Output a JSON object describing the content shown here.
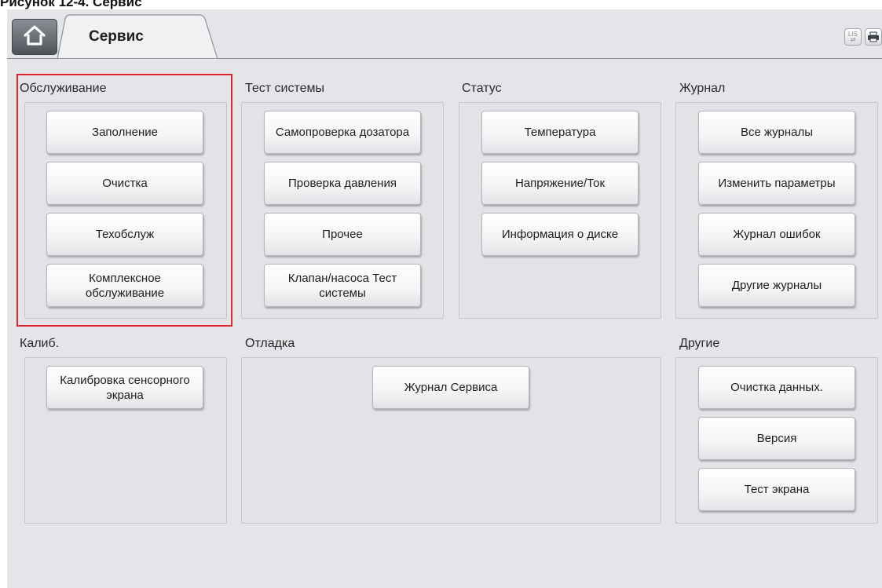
{
  "caption": "Рисунок 12-4. Сервис",
  "header": {
    "tab_label": "Сервис",
    "icons": {
      "lis": "LIS\n⇄",
      "print": "printer-icon"
    }
  },
  "groups": {
    "maintenance": {
      "title": "Обслуживание",
      "buttons": [
        "Заполнение",
        "Очистка",
        "Техобслуж",
        "Комплексное обслуживание"
      ]
    },
    "system_test": {
      "title": "Тест системы",
      "buttons": [
        "Самопроверка дозатора",
        "Проверка давления",
        "Прочее",
        "Клапан/насоса Тест системы"
      ]
    },
    "status": {
      "title": "Статус",
      "buttons": [
        "Температура",
        "Напряжение/Ток",
        "Информация о диске"
      ]
    },
    "log": {
      "title": "Журнал",
      "buttons": [
        "Все журналы",
        "Изменить параметры",
        "Журнал ошибок",
        "Другие журналы"
      ]
    },
    "calib": {
      "title": "Калиб.",
      "buttons": [
        "Калибровка сенсорного экрана"
      ]
    },
    "debug": {
      "title": "Отладка",
      "buttons": [
        "Журнал Сервиса"
      ]
    },
    "other": {
      "title": "Другие",
      "buttons": [
        "Очистка данных.",
        "Версия",
        "Тест экрана"
      ]
    }
  },
  "colors": {
    "highlight": "#e0262c",
    "background": "#e4e5e9"
  }
}
